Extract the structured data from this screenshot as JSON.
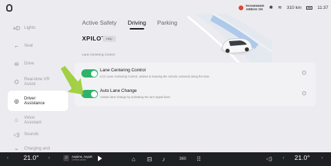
{
  "status": {
    "airbag_line1": "PASSENGER",
    "airbag_line2": "AIRBAG ON",
    "bluetooth_icon": "bluetooth-icon",
    "wifi_icon": "wifi-icon",
    "range": "310 km",
    "time": "11:37"
  },
  "sidebar": {
    "items": [
      {
        "label": "Lights",
        "icon": "lights-icon"
      },
      {
        "label": "Seat",
        "icon": "seat-icon"
      },
      {
        "label": "Drive",
        "icon": "drive-icon"
      },
      {
        "label": "Real-time VR Assist",
        "icon": "vr-assist-icon"
      },
      {
        "label": "Driver Assistance",
        "icon": "steering-wheel-icon"
      },
      {
        "label": "Voice Assistant",
        "icon": "voice-icon"
      },
      {
        "label": "Sounds",
        "icon": "sound-icon"
      },
      {
        "label": "Charging and",
        "icon": "charging-icon"
      }
    ],
    "active_index": 4
  },
  "tabs": [
    "Active Safety",
    "Driving",
    "Parking"
  ],
  "active_tab": "Driving",
  "xpilot": {
    "title": "XPILOT",
    "badge": "Help"
  },
  "section_title": "Lane Centering Control",
  "settings": [
    {
      "title": "Lane Centering Control",
      "description": "LCC Lane Centering Control, assists in keeping the vehicle centered along the lane.",
      "enabled": true
    },
    {
      "title": "Auto Lane Change",
      "description": "Assists lane change by activating the turn signal lever",
      "enabled": true
    }
  ],
  "colors": {
    "toggle_on": "#2fb36a",
    "arrow": "#9acd32",
    "dock_bg": "#1f2023",
    "airbag": "#d84a3a"
  },
  "dock": {
    "temp_left": "21.0°",
    "temp_right": "21.0°",
    "media_title": "Anytime, Anywh",
    "media_subtitle": "Central audio",
    "icons": [
      "home-icon",
      "car-icon",
      "music-icon",
      "360-view-icon",
      "apps-grid-icon"
    ],
    "label_360": "360"
  }
}
